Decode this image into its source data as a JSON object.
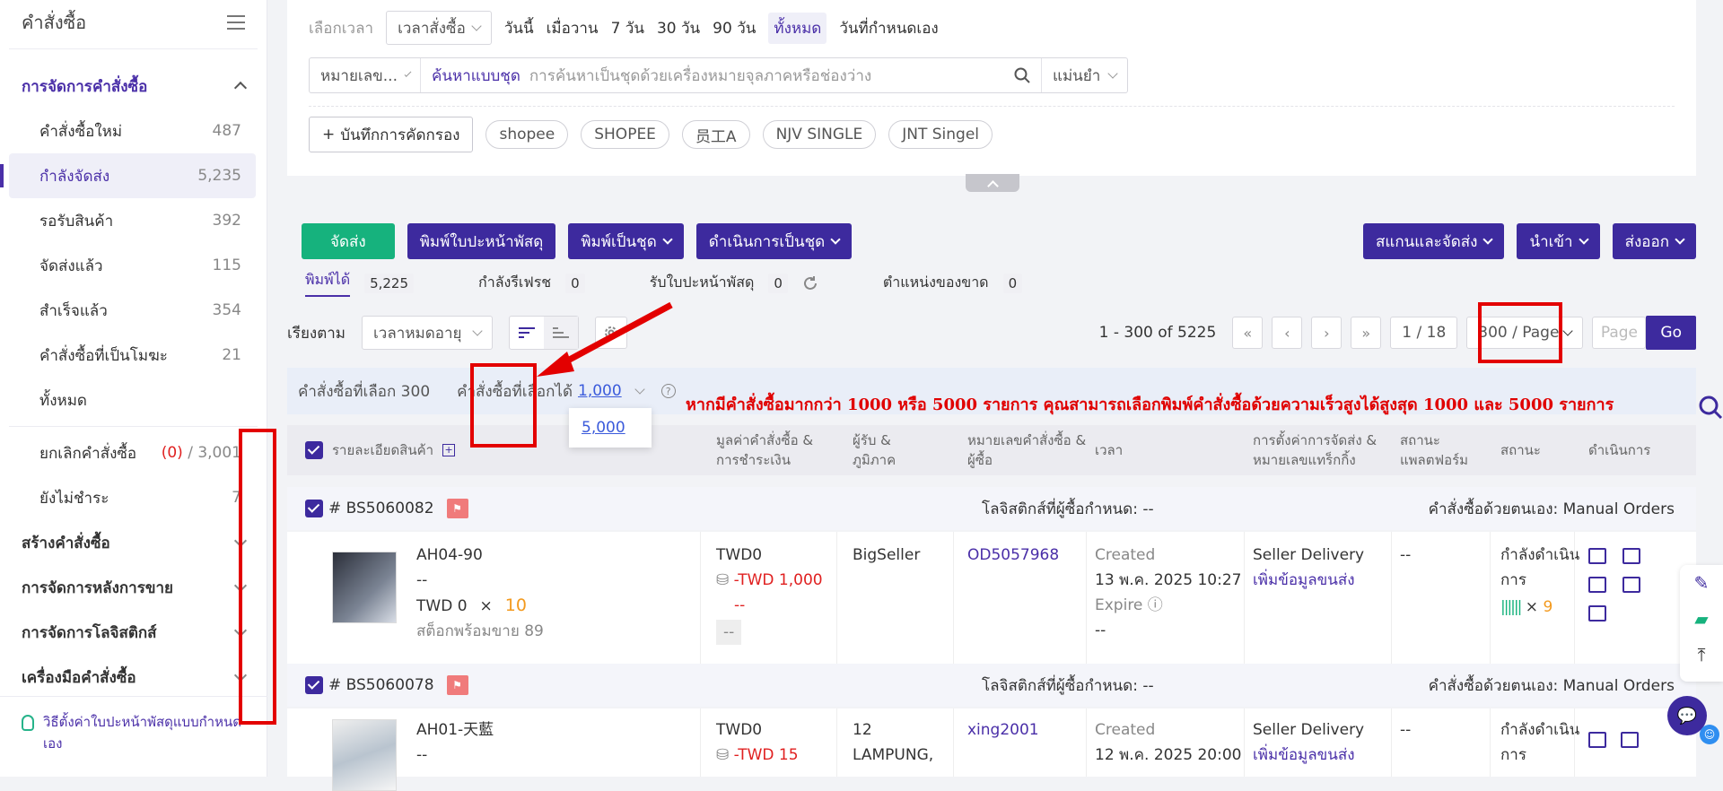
{
  "sidebar": {
    "title": "คำสั่งซื้อ",
    "group_manage": "การจัดการคำสั่งซื้อ",
    "items": [
      {
        "label": "คำสั่งซื้อใหม่",
        "count": "487"
      },
      {
        "label": "กำลังจัดส่ง",
        "count": "5,235"
      },
      {
        "label": "รอรับสินค้า",
        "count": "392"
      },
      {
        "label": "จัดส่งแล้ว",
        "count": "115"
      },
      {
        "label": "สำเร็จแล้ว",
        "count": "354"
      },
      {
        "label": "คำสั่งซื้อที่เป็นโมฆะ",
        "count": "21"
      },
      {
        "label": "ทั้งหมด",
        "count": ""
      }
    ],
    "cancel": {
      "label": "ยกเลิกคำสั่งซื้อ",
      "red": "(0)",
      "total": "/ 3,001"
    },
    "unpaid": {
      "label": "ยังไม่ชำระ",
      "count": "7"
    },
    "groups": [
      "สร้างคำสั่งซื้อ",
      "การจัดการหลังการขาย",
      "การจัดการโลจิสติกส์",
      "เครื่องมือคำสั่งซื้อ"
    ],
    "footer": "วิธีตั้งค่าใบปะหน้าพัสดุแบบกำหนดเอง"
  },
  "filter": {
    "time_label": "เลือกเวลา",
    "time_select": "เวลาสั่งซื้อ",
    "time_links": [
      "วันนี้",
      "เมื่อวาน",
      "7 วัน",
      "30 วัน",
      "90 วัน",
      "ทั้งหมด",
      "วันที่กำหนดเอง"
    ],
    "search_type": "หมายเลข...",
    "batch_search": "ค้นหาแบบชุด",
    "search_placeholder": "การค้นหาเป็นชุดด้วยเครื่องหมายจุลภาคหรือช่องว่าง",
    "match": "แม่นยำ",
    "save_filter": "บันทึกการคัดกรอง",
    "tags": [
      "shopee",
      "SHOPEE",
      "员工A",
      "NJV SINGLE",
      "JNT Singel"
    ]
  },
  "toolbar": {
    "ship": "จัดส่ง",
    "print_label": "พิมพ์ใบปะหน้าพัสดุ",
    "print_batch": "พิมพ์เป็นชุด",
    "batch_ops": "ดำเนินการเป็นชุด",
    "scan_ship": "สแกนและจัดส่ง",
    "import": "นำเข้า",
    "export": "ส่งออก"
  },
  "tabs": [
    {
      "label": "พิมพ์ได้",
      "count": "5,225"
    },
    {
      "label": "กำลังรีเฟรช",
      "count": "0"
    },
    {
      "label": "รับใบปะหน้าพัสดุ",
      "count": "0"
    },
    {
      "label": "ตำแหน่งของขาด",
      "count": "0"
    }
  ],
  "sort": {
    "label": "เรียงตาม",
    "value": "เวลาหมดอายุ"
  },
  "pager": {
    "range": "1 - 300 of 5225",
    "page": "1 / 18",
    "per_page": "300 / Page",
    "page_placeholder": "Page",
    "go": "Go"
  },
  "selection": {
    "selected": "คำสั่งซื้อที่เลือก 300",
    "selectable": "คำสั่งซื้อที่เลือกได้",
    "opt1": "1,000",
    "opt2": "5,000"
  },
  "annotation": "หากมีคำสั่งซื้อมากกว่า 1000 หรือ 5000 รายการ คุณสามารถเลือกพิมพ์คำสั่งซื้อด้วยความเร็วสูงได้สูงสุด 1000 และ 5000 รายการ",
  "columns": [
    "รายละเอียดสินค้า",
    "มูลค่าคำสั่งซื้อ & การชำระเงิน",
    "ผู้รับ & ภูมิภาค",
    "หมายเลขคำสั่งซื้อ & ผู้ซื้อ",
    "เวลา",
    "การตั้งค่าการจัดส่ง & หมายเลขแทร็กกิ้ง",
    "สถานะแพลตฟอร์ม",
    "สถานะ",
    "ดำเนินการ"
  ],
  "orders": [
    {
      "id": "# BS5060082",
      "logistics": "โลจิสติกส์ที่ผู้ซื้อกำหนด: --",
      "source": "คำสั่งซื้อด้วยตนเอง: Manual Orders",
      "sku": "AH04-90",
      "dash": "--",
      "price": "TWD 0",
      "qty": "10",
      "stock": "สต็อกพร้อมขาย 89",
      "amount": "TWD0",
      "refund": "-TWD 1,000",
      "dash2": "--",
      "dash3": "--",
      "recipient": "BigSeller",
      "order_no": "OD5057968",
      "created_label": "Created",
      "created": "13 พ.ค. 2025 10:27",
      "expire": "Expire",
      "expire_val": "--",
      "delivery": "Seller Delivery",
      "add_info": "เพิ่มข้อมูลขนส่ง",
      "platform": "--",
      "status": "กำลังดำเนินการ",
      "barcode_qty": "9"
    },
    {
      "id": "# BS5060078",
      "logistics": "โลจิสติกส์ที่ผู้ซื้อกำหนด: --",
      "source": "คำสั่งซื้อด้วยตนเอง: Manual Orders",
      "sku": "AH01-天藍",
      "dash": "--",
      "amount": "TWD0",
      "refund": "-TWD 15",
      "recipient": "12 LAMPUNG,",
      "order_no": "xing2001",
      "created_label": "Created",
      "created": "12 พ.ค. 2025 20:00",
      "delivery": "Seller Delivery",
      "add_info": "เพิ่มข้อมูลขนส่ง",
      "platform": "--",
      "status": "กำลังดำเนินการ"
    }
  ]
}
